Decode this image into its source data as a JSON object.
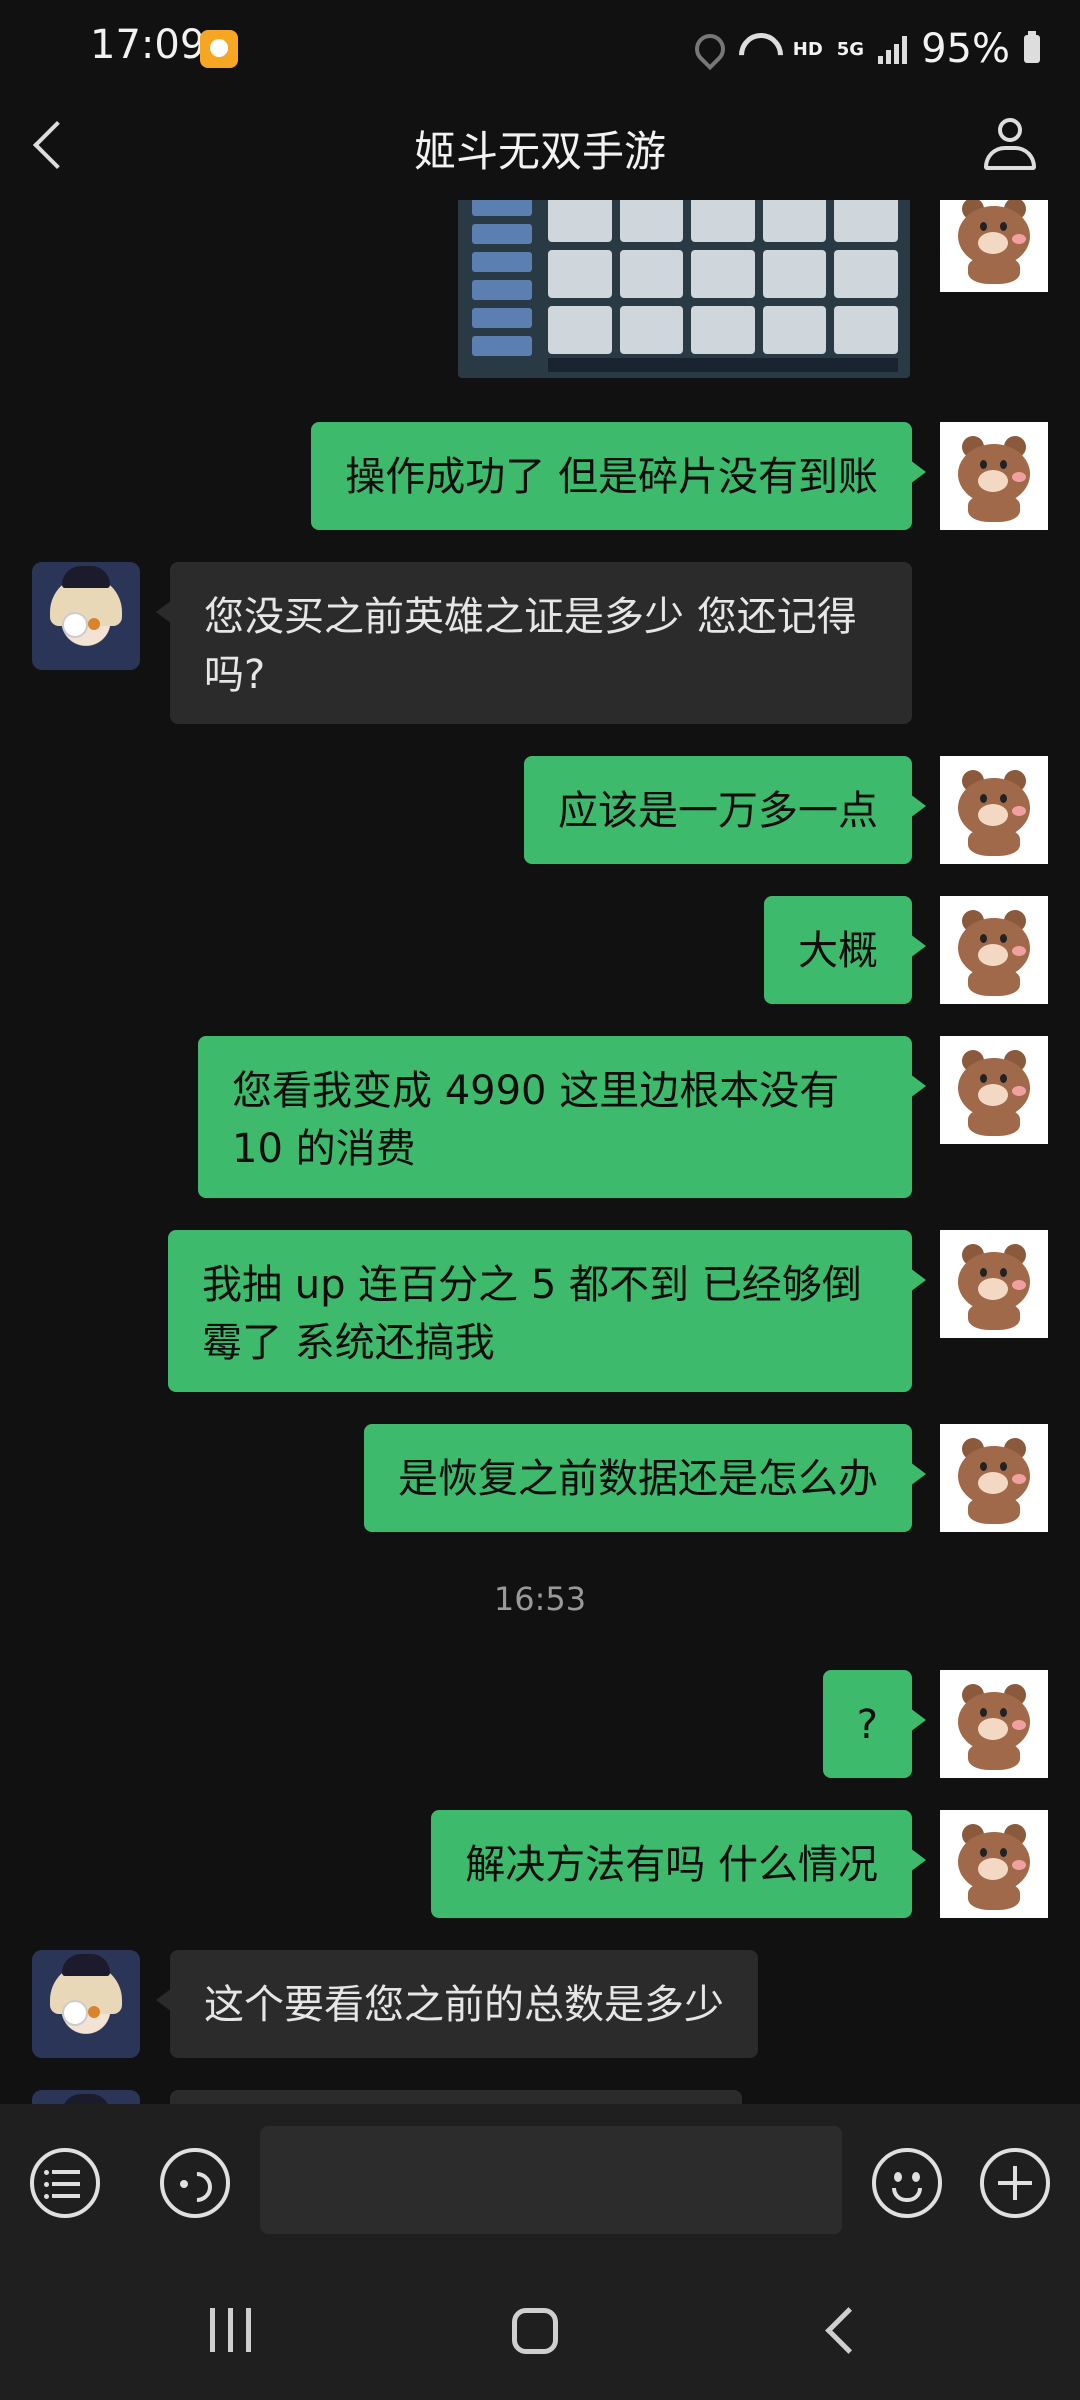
{
  "status_bar": {
    "time": "17:09",
    "network_hd": "HD",
    "network_type": "5G",
    "battery": "95%"
  },
  "header": {
    "title": "姬斗无双手游"
  },
  "messages": [
    {
      "sender": "me",
      "type": "image"
    },
    {
      "sender": "me",
      "text": "操作成功了 但是碎片没有到账"
    },
    {
      "sender": "cs",
      "text": "您没买之前英雄之证是多少 您还记得吗?"
    },
    {
      "sender": "me",
      "text": "应该是一万多一点"
    },
    {
      "sender": "me",
      "text": "大概"
    },
    {
      "sender": "me",
      "text": "您看我变成 4990 这里边根本没有 10 的消费"
    },
    {
      "sender": "me",
      "text": "我抽 up 连百分之 5 都不到 已经够倒霉了 系统还搞我"
    },
    {
      "sender": "me",
      "text": "是恢复之前数据还是怎么办"
    },
    {
      "type": "timestamp",
      "text": "16:53"
    },
    {
      "sender": "me",
      "text": "?"
    },
    {
      "sender": "me",
      "text": "解决方法有吗 什么情况"
    },
    {
      "sender": "cs",
      "text": "这个要看您之前的总数是多少"
    },
    {
      "sender": "cs",
      "text": ""
    }
  ],
  "input": {
    "placeholder": ""
  },
  "colors": {
    "background": "#111111",
    "my_bubble": "#3dba6c",
    "their_bubble": "#2b2b2b",
    "bar": "#1f1f1f"
  }
}
